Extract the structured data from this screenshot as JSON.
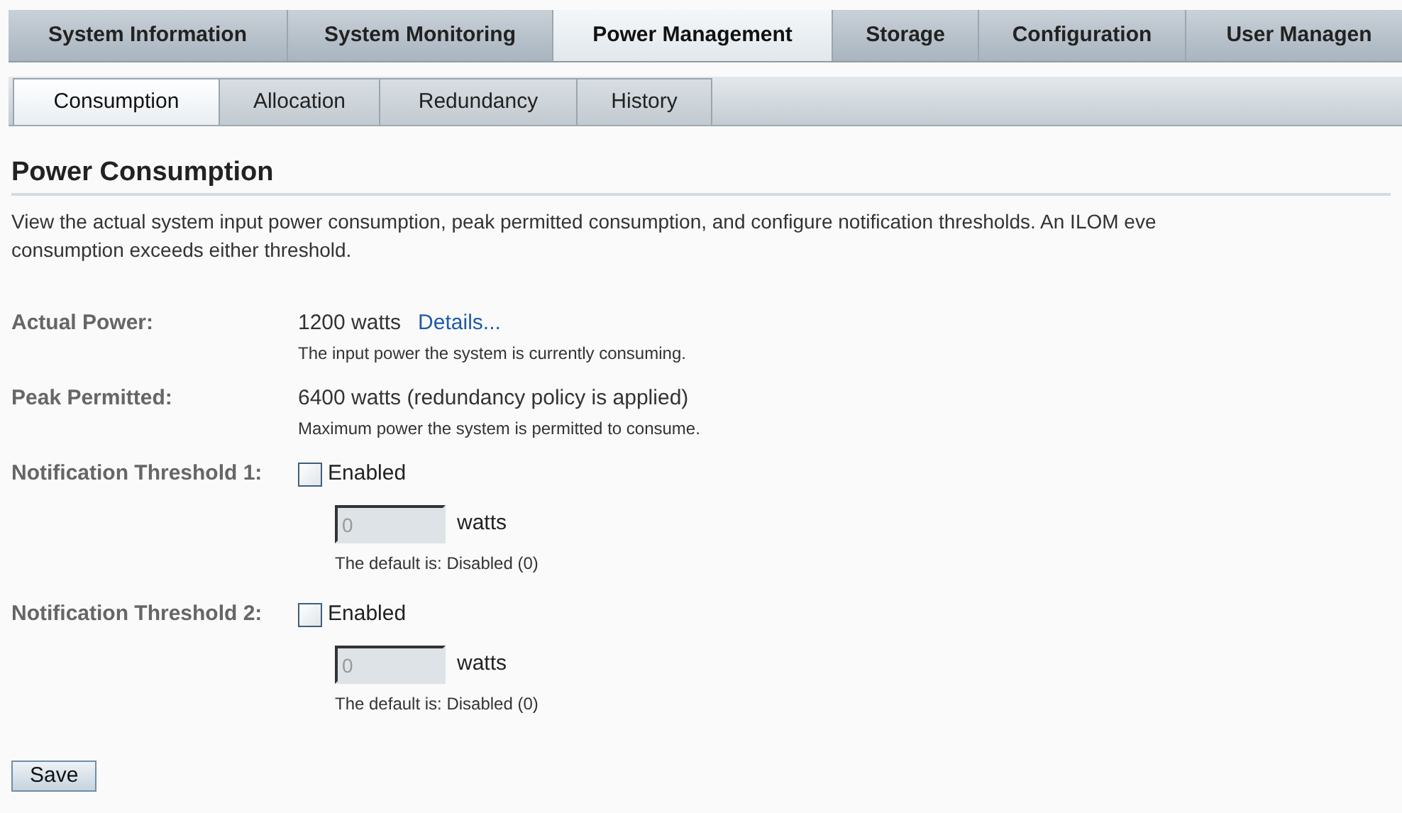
{
  "main_tabs": [
    {
      "label": "System Information",
      "selected": false
    },
    {
      "label": "System Monitoring",
      "selected": false
    },
    {
      "label": "Power Management",
      "selected": true
    },
    {
      "label": "Storage",
      "selected": false
    },
    {
      "label": "Configuration",
      "selected": false
    },
    {
      "label": "User Managen",
      "selected": false
    }
  ],
  "sub_tabs": [
    {
      "label": "Consumption",
      "selected": true
    },
    {
      "label": "Allocation",
      "selected": false
    },
    {
      "label": "Redundancy",
      "selected": false
    },
    {
      "label": "History",
      "selected": false
    }
  ],
  "heading": "Power Consumption",
  "description_lines": [
    "View the actual system input power consumption, peak permitted consumption, and configure notification thresholds. An ILOM eve",
    "consumption exceeds either threshold."
  ],
  "fields": [
    {
      "kind": "reading",
      "label": "Actual Power:",
      "value": "1200 watts",
      "link": "Details...",
      "hint": "The input power the system is currently consuming."
    },
    {
      "kind": "reading",
      "label": "Peak Permitted:",
      "value": "6400 watts (redundancy policy is applied)",
      "hint": "Maximum power the system is permitted to consume."
    },
    {
      "kind": "threshold",
      "label": "Notification Threshold 1:",
      "checkbox_label": "Enabled",
      "checked": false,
      "input_value": "0",
      "disabled": true,
      "unit": "watts",
      "hint": "The default is: Disabled (0)"
    },
    {
      "kind": "threshold",
      "label": "Notification Threshold 2:",
      "checkbox_label": "Enabled",
      "checked": false,
      "input_value": "0",
      "disabled": true,
      "unit": "watts",
      "hint": "The default is: Disabled (0)"
    }
  ],
  "save_button": "Save"
}
